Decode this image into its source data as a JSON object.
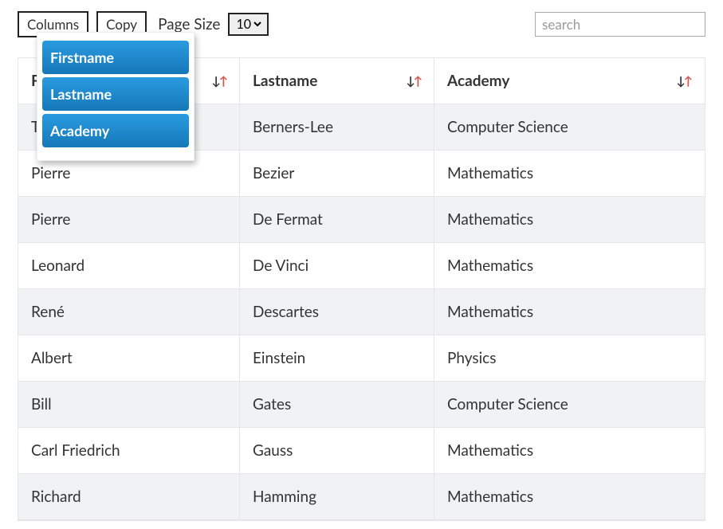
{
  "toolbar": {
    "columns_button": "Columns",
    "copy_button": "Copy",
    "page_size_label": "Page Size",
    "page_size_value": "10",
    "search_placeholder": "search"
  },
  "dropdown": {
    "items": [
      "Firstname",
      "Lastname",
      "Academy"
    ]
  },
  "table": {
    "headers": {
      "firstname": "Firstname",
      "lastname": "Lastname",
      "academy": "Academy"
    },
    "rows": [
      {
        "firstname": "Tim",
        "lastname": "Berners-Lee",
        "academy": "Computer Science"
      },
      {
        "firstname": "Pierre",
        "lastname": "Bezier",
        "academy": "Mathematics"
      },
      {
        "firstname": "Pierre",
        "lastname": "De Fermat",
        "academy": "Mathematics"
      },
      {
        "firstname": "Leonard",
        "lastname": "De Vinci",
        "academy": "Mathematics"
      },
      {
        "firstname": "René",
        "lastname": "Descartes",
        "academy": "Mathematics"
      },
      {
        "firstname": "Albert",
        "lastname": "Einstein",
        "academy": "Physics"
      },
      {
        "firstname": "Bill",
        "lastname": "Gates",
        "academy": "Computer Science"
      },
      {
        "firstname": "Carl Friedrich",
        "lastname": "Gauss",
        "academy": "Mathematics"
      },
      {
        "firstname": "Richard",
        "lastname": "Hamming",
        "academy": "Mathematics"
      }
    ]
  }
}
